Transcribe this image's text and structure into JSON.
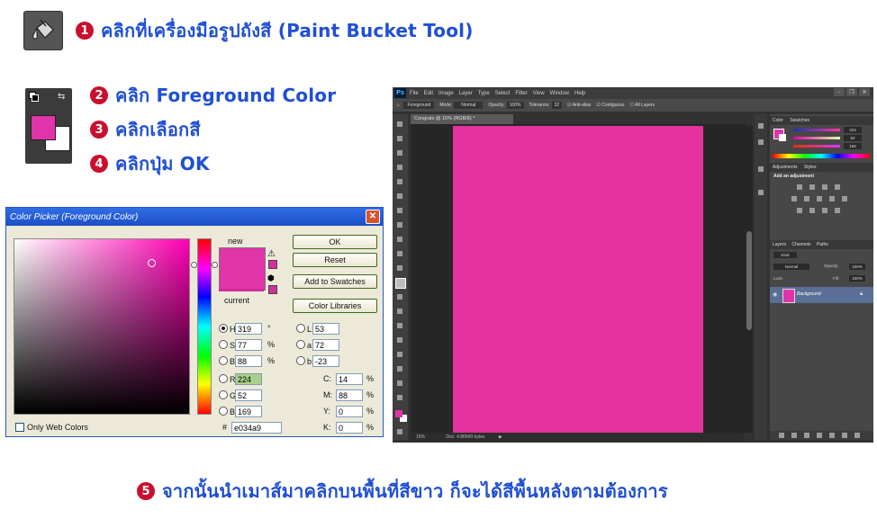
{
  "steps": [
    {
      "num": "1",
      "text": "คลิกที่เครื่องมือรูปถังสี (Paint Bucket Tool)"
    },
    {
      "num": "2",
      "text": "คลิก Foreground Color"
    },
    {
      "num": "3",
      "text": "คลิกเลือกสี"
    },
    {
      "num": "4",
      "text": "คลิกปุ่ม OK"
    },
    {
      "num": "5",
      "text": "จากนั้นนำเมาส์มาคลิกบนพื้นที่สีขาว ก็จะได้สีพื้นหลังตามต้องการ"
    }
  ],
  "colors": {
    "step_text": "#1f4fd3",
    "step_number_bg": "#c8102e",
    "picked": "#e034a9",
    "canvas": "#e4329e"
  },
  "color_picker": {
    "title": "Color Picker (Foreground Color)",
    "new_label": "new",
    "current_label": "current",
    "buttons": {
      "ok": "OK",
      "reset": "Reset",
      "add_to_swatches": "Add to Swatches",
      "color_libraries": "Color Libraries"
    },
    "hsb": [
      {
        "label": "H:",
        "value": "319",
        "unit": "°"
      },
      {
        "label": "S:",
        "value": "77",
        "unit": "%"
      },
      {
        "label": "B:",
        "value": "88",
        "unit": "%"
      }
    ],
    "rgb": [
      {
        "label": "R:",
        "value": "224"
      },
      {
        "label": "G:",
        "value": "52"
      },
      {
        "label": "B:",
        "value": "169"
      }
    ],
    "lab": [
      {
        "label": "L:",
        "value": "53"
      },
      {
        "label": "a:",
        "value": "72"
      },
      {
        "label": "b:",
        "value": "-23"
      }
    ],
    "cmyk": [
      {
        "label": "C:",
        "value": "14",
        "unit": "%"
      },
      {
        "label": "M:",
        "value": "88",
        "unit": "%"
      },
      {
        "label": "Y:",
        "value": "0",
        "unit": "%"
      },
      {
        "label": "K:",
        "value": "0",
        "unit": "%"
      }
    ],
    "hex_label": "#",
    "hex_value": "e034a9",
    "only_web_colors": "Only Web Colors"
  },
  "photoshop": {
    "logo": "Ps",
    "menu": [
      "File",
      "Edit",
      "Image",
      "Layer",
      "Type",
      "Select",
      "Filter",
      "View",
      "Window",
      "Help"
    ],
    "options": {
      "fill": "Foreground",
      "mode_label": "Mode:",
      "mode": "Normal",
      "opacity_label": "Opacity:",
      "opacity": "100%",
      "tolerance_label": "Tolerance:",
      "tolerance": "32",
      "anti_alias": "Anti-alias",
      "contiguous": "Contiguous",
      "all_layers": "All Layers"
    },
    "doc_tab": "Congrats @ 15% (RGB/8) *",
    "status_zoom": "15%",
    "status_doc": "Doc: 4.86M/0 bytes",
    "panels": {
      "color_tabs": [
        "Color",
        "Swatches"
      ],
      "rgb_values": [
        "224",
        "52",
        "169"
      ],
      "adjust_tabs": [
        "Adjustments",
        "Styles"
      ],
      "adjust_title": "Add an adjustment",
      "layer_tabs": [
        "Layers",
        "Channels",
        "Paths"
      ],
      "kind": "Kind",
      "blend": "Normal",
      "opacity_label": "Opacity:",
      "opacity": "100%",
      "lock_label": "Lock:",
      "fill_label": "Fill:",
      "fill": "100%",
      "layer_name": "Background"
    }
  }
}
